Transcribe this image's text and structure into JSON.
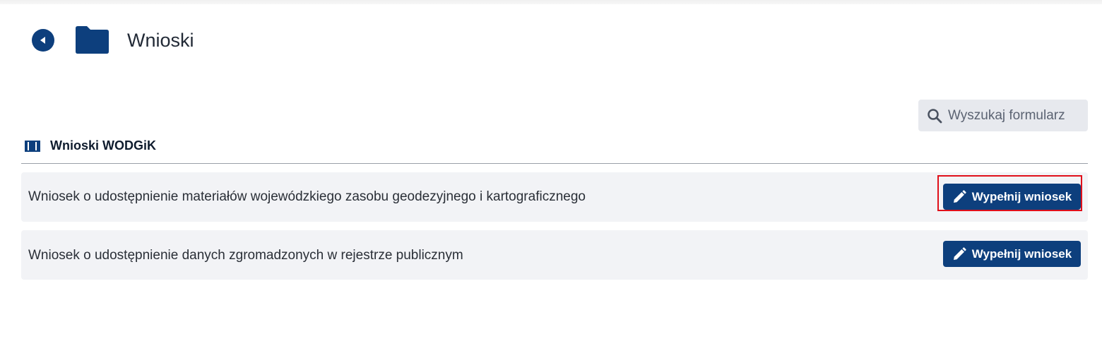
{
  "header": {
    "title": "Wnioski",
    "back_icon": "back-arrow-circle-icon",
    "folder_icon": "folder-icon"
  },
  "search": {
    "placeholder": "Wyszukaj formularz",
    "icon": "search-icon"
  },
  "section": {
    "title": "Wnioski WODGiK",
    "icon": "binder-icon"
  },
  "forms": [
    {
      "name": "Wniosek o udostępnienie materiałów wojewódzkiego zasobu geodezyjnego i kartograficznego",
      "button_label": "Wypełnij wniosek",
      "highlighted": true
    },
    {
      "name": "Wniosek o udostępnienie danych zgromadzonych w rejestrze publicznym",
      "button_label": "Wypełnij wniosek",
      "highlighted": false
    }
  ],
  "colors": {
    "accent": "#0d3f7d",
    "row_background": "#f2f3f6",
    "highlight": "#e0101a"
  }
}
